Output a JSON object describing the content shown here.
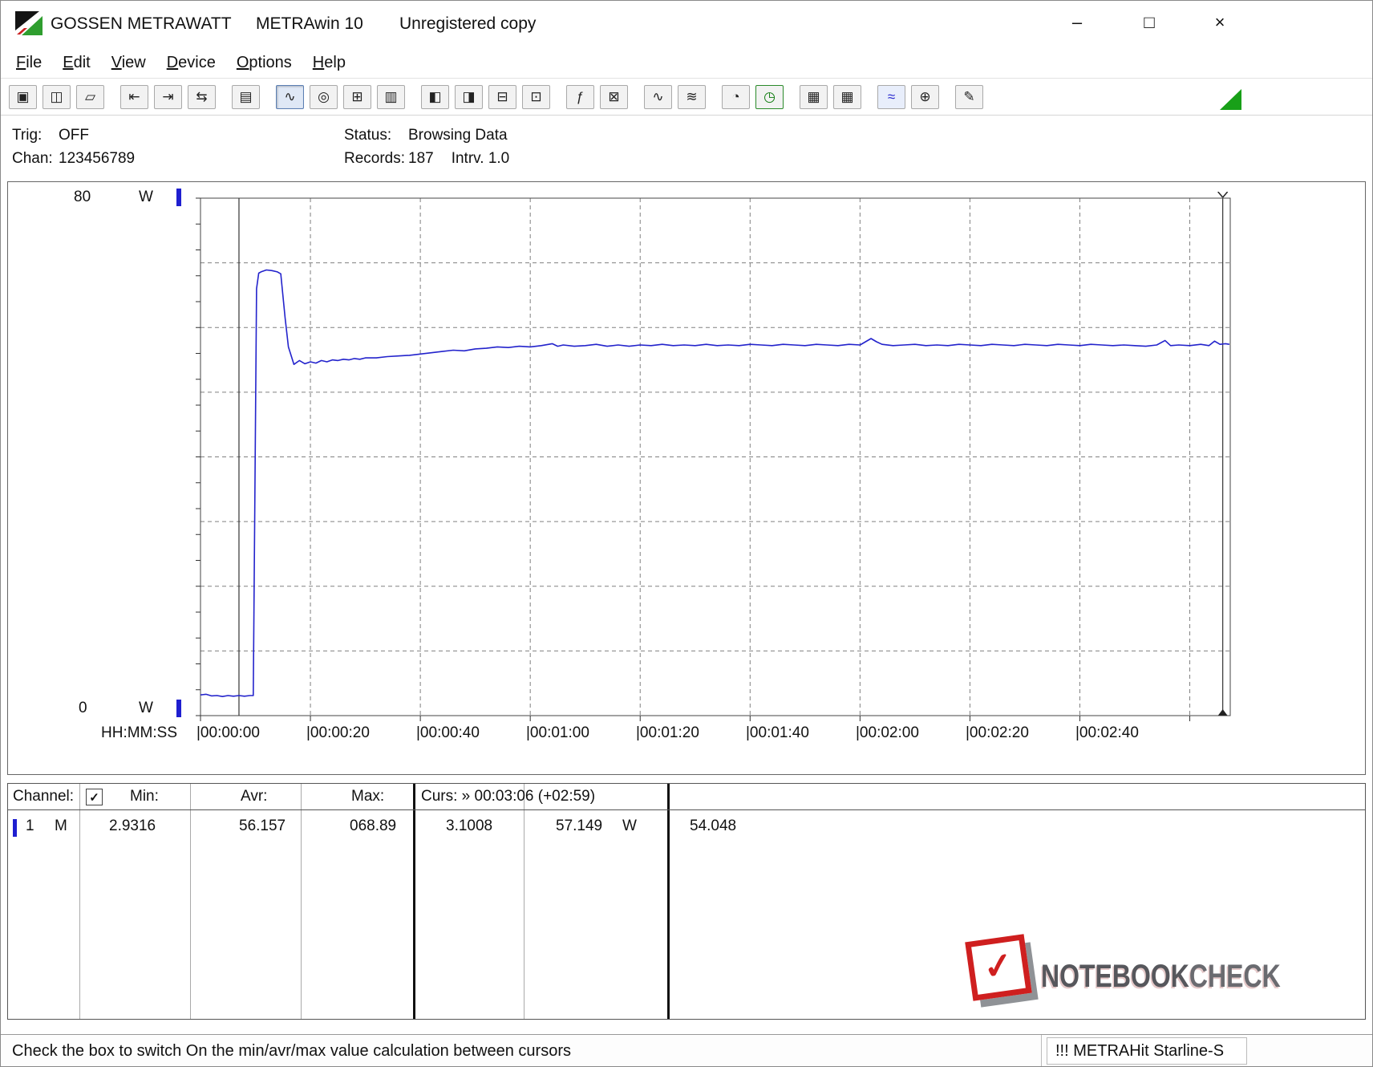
{
  "colors": {
    "series": "#2323cc",
    "marker_blue": "#1f1fd0",
    "grid": "#808080",
    "toolbar_green": "#18a018",
    "watermark_red": "#cf1f1f"
  },
  "window": {
    "brand": "GOSSEN METRAWATT",
    "app": "METRAwin 10",
    "license": "Unregistered copy",
    "controls": {
      "minimize": "–",
      "maximize": "□",
      "close": "×"
    }
  },
  "menu": {
    "items": [
      "File",
      "Edit",
      "View",
      "Device",
      "Options",
      "Help"
    ]
  },
  "toolbar": {
    "icons": [
      {
        "name": "save-icon",
        "glyph": "▣"
      },
      {
        "name": "save-all-icon",
        "glyph": "◫"
      },
      {
        "name": "open-file-icon",
        "glyph": "▱"
      },
      {
        "sep": true
      },
      {
        "name": "export-begin-icon",
        "glyph": "⇤"
      },
      {
        "name": "export-data-icon",
        "glyph": "⇥"
      },
      {
        "name": "transfer-icon",
        "glyph": "⇆"
      },
      {
        "sep": true
      },
      {
        "name": "channel-list-icon",
        "glyph": "▤"
      },
      {
        "sep": true
      },
      {
        "name": "trend-view-icon",
        "glyph": "∿",
        "selected": true
      },
      {
        "name": "scope-view-icon",
        "glyph": "◎"
      },
      {
        "name": "table-view-icon",
        "glyph": "⊞"
      },
      {
        "name": "bar-view-icon",
        "glyph": "▥"
      },
      {
        "sep": true
      },
      {
        "name": "window-config-icon",
        "glyph": "◧"
      },
      {
        "name": "window-tile-icon",
        "glyph": "◨"
      },
      {
        "name": "window-split-icon",
        "glyph": "⊟"
      },
      {
        "name": "monitor-view-icon",
        "glyph": "⊡"
      },
      {
        "sep": true
      },
      {
        "name": "formula-icon",
        "glyph": "ƒ"
      },
      {
        "name": "counter-icon",
        "glyph": "⊠"
      },
      {
        "sep": true
      },
      {
        "name": "wave-compress-icon",
        "glyph": "∿"
      },
      {
        "name": "wave-expand-icon",
        "glyph": "≋"
      },
      {
        "sep": true
      },
      {
        "name": "time-sync-icon",
        "glyph": "◔"
      },
      {
        "name": "alarm-clock-icon",
        "glyph": "◷",
        "green": true
      },
      {
        "sep": true
      },
      {
        "name": "print-icon",
        "glyph": "▦"
      },
      {
        "name": "print-preview-icon",
        "glyph": "▦"
      },
      {
        "sep": true
      },
      {
        "name": "zoom-curve-icon",
        "glyph": "≈",
        "blue": true
      },
      {
        "name": "zoom-icon",
        "glyph": "⊕"
      },
      {
        "sep": true
      },
      {
        "name": "annotation-icon",
        "glyph": "✎"
      }
    ]
  },
  "info": {
    "trig_label": "Trig:",
    "trig_value": "OFF",
    "chan_label": "Chan:",
    "chan_value": "123456789",
    "status_label": "Status:",
    "status_value": "Browsing Data",
    "records_label": "Records:",
    "records_value": "187",
    "intrv_label": "Intrv.",
    "intrv_value": "1.0"
  },
  "table": {
    "header": {
      "channel": "Channel:",
      "checked": true,
      "min": "Min:",
      "avr": "Avr:",
      "max": "Max:",
      "curs": "Curs: » 00:03:06 (+02:59)"
    },
    "row": {
      "ch": "1",
      "mode": "M",
      "min": "2.9316",
      "avr": "56.157",
      "max": "068.89",
      "cursor1": "3.1008",
      "cursor2": "57.149",
      "unit": "W",
      "delta": "54.048"
    }
  },
  "statusbar": {
    "hint": "Check the box to switch On the min/avr/max value calculation between cursors",
    "device": "!!! METRAHit Starline-S"
  },
  "watermark": {
    "text1": "NOTEBOOK",
    "text2": "CHECK"
  },
  "chart_data": {
    "type": "line",
    "ylabel": "W",
    "y_unit": "W",
    "y_max": "80",
    "y_min": "0",
    "ylim": [
      0,
      80
    ],
    "x_axis_label": "HH:MM:SS",
    "x_ticks": [
      "00:00:00",
      "00:00:20",
      "00:00:40",
      "00:01:00",
      "00:01:20",
      "00:01:40",
      "00:02:00",
      "00:02:20",
      "00:02:40"
    ],
    "x_tick_interval_s": 20,
    "x_range_s": [
      0,
      187.2
    ],
    "grid": "dashed",
    "stats": {
      "min": 2.9316,
      "avr": 56.157,
      "max": 68.89
    },
    "cursors": {
      "cursor1_t_s": 7,
      "cursor2_t_s": 186,
      "cursor1_value_w": 3.1008,
      "cursor2_value_w": 57.149,
      "delta_w": 54.048,
      "curs_label": "00:03:06 (+02:59)"
    },
    "series": [
      {
        "name": "Channel 1 (M) Power W",
        "points": [
          [
            0,
            3.2
          ],
          [
            1,
            3.3
          ],
          [
            2,
            3.05
          ],
          [
            3,
            3.1
          ],
          [
            4,
            2.95
          ],
          [
            5,
            3.1
          ],
          [
            6,
            3.0
          ],
          [
            7,
            3.1
          ],
          [
            8,
            3.0
          ],
          [
            9,
            3.1
          ],
          [
            9.6,
            3.1
          ],
          [
            10.2,
            66.0
          ],
          [
            10.6,
            68.4
          ],
          [
            11,
            68.6
          ],
          [
            12,
            68.9
          ],
          [
            13,
            68.8
          ],
          [
            14,
            68.6
          ],
          [
            14.6,
            68.3
          ],
          [
            15.4,
            61.5
          ],
          [
            16,
            57.0
          ],
          [
            17,
            54.3
          ],
          [
            18,
            54.9
          ],
          [
            19,
            54.4
          ],
          [
            20,
            54.7
          ],
          [
            21,
            54.5
          ],
          [
            22,
            54.9
          ],
          [
            23,
            54.7
          ],
          [
            24,
            55.0
          ],
          [
            25,
            54.9
          ],
          [
            26,
            55.1
          ],
          [
            27,
            55.0
          ],
          [
            28,
            55.2
          ],
          [
            29,
            55.1
          ],
          [
            30,
            55.3
          ],
          [
            32,
            55.3
          ],
          [
            34,
            55.5
          ],
          [
            36,
            55.6
          ],
          [
            38,
            55.7
          ],
          [
            40,
            55.9
          ],
          [
            42,
            56.1
          ],
          [
            44,
            56.3
          ],
          [
            46,
            56.5
          ],
          [
            48,
            56.4
          ],
          [
            50,
            56.7
          ],
          [
            52,
            56.8
          ],
          [
            54,
            57.0
          ],
          [
            56,
            56.9
          ],
          [
            58,
            57.1
          ],
          [
            60,
            57.0
          ],
          [
            62,
            57.2
          ],
          [
            64,
            57.5
          ],
          [
            65,
            57.1
          ],
          [
            66,
            57.3
          ],
          [
            68,
            57.1
          ],
          [
            70,
            57.2
          ],
          [
            72,
            57.4
          ],
          [
            74,
            57.1
          ],
          [
            76,
            57.3
          ],
          [
            78,
            57.1
          ],
          [
            80,
            57.3
          ],
          [
            82,
            57.2
          ],
          [
            84,
            57.4
          ],
          [
            86,
            57.2
          ],
          [
            88,
            57.3
          ],
          [
            90,
            57.2
          ],
          [
            92,
            57.4
          ],
          [
            94,
            57.2
          ],
          [
            96,
            57.3
          ],
          [
            98,
            57.2
          ],
          [
            100,
            57.4
          ],
          [
            102,
            57.3
          ],
          [
            104,
            57.2
          ],
          [
            106,
            57.4
          ],
          [
            108,
            57.3
          ],
          [
            110,
            57.2
          ],
          [
            112,
            57.4
          ],
          [
            114,
            57.3
          ],
          [
            116,
            57.2
          ],
          [
            118,
            57.4
          ],
          [
            120,
            57.3
          ],
          [
            122,
            58.3
          ],
          [
            123,
            57.8
          ],
          [
            124,
            57.4
          ],
          [
            126,
            57.2
          ],
          [
            128,
            57.3
          ],
          [
            130,
            57.4
          ],
          [
            132,
            57.2
          ],
          [
            134,
            57.3
          ],
          [
            136,
            57.2
          ],
          [
            138,
            57.4
          ],
          [
            140,
            57.3
          ],
          [
            142,
            57.2
          ],
          [
            144,
            57.4
          ],
          [
            146,
            57.3
          ],
          [
            148,
            57.2
          ],
          [
            150,
            57.4
          ],
          [
            152,
            57.3
          ],
          [
            154,
            57.2
          ],
          [
            156,
            57.4
          ],
          [
            158,
            57.3
          ],
          [
            160,
            57.2
          ],
          [
            162,
            57.4
          ],
          [
            164,
            57.3
          ],
          [
            166,
            57.2
          ],
          [
            168,
            57.3
          ],
          [
            170,
            57.2
          ],
          [
            172,
            57.1
          ],
          [
            174,
            57.3
          ],
          [
            175.5,
            58.0
          ],
          [
            176.5,
            57.2
          ],
          [
            178,
            57.3
          ],
          [
            180,
            57.2
          ],
          [
            182,
            57.4
          ],
          [
            183.5,
            57.2
          ],
          [
            184.5,
            57.9
          ],
          [
            185.5,
            57.4
          ],
          [
            186.5,
            57.5
          ],
          [
            187.2,
            57.4
          ]
        ]
      }
    ]
  }
}
